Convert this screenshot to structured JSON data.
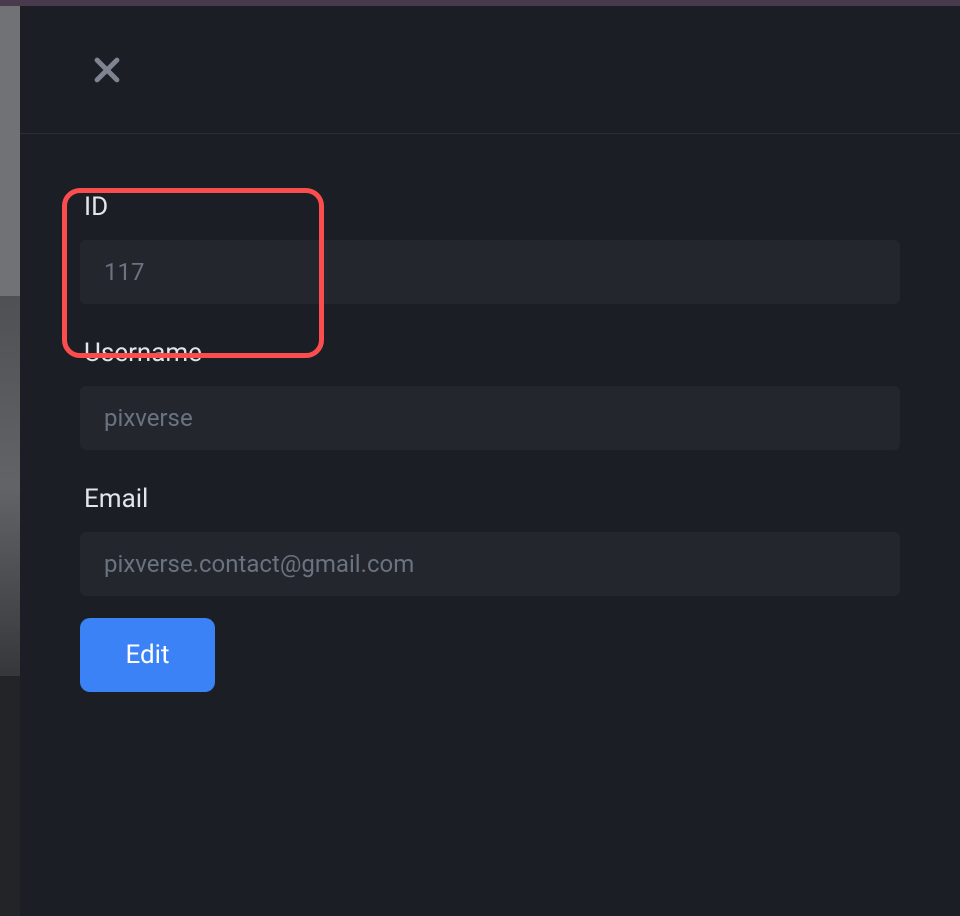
{
  "form": {
    "id": {
      "label": "ID",
      "value": "117"
    },
    "username": {
      "label": "Username",
      "value": "pixverse"
    },
    "email": {
      "label": "Email",
      "value": "pixverse.contact@gmail.com"
    },
    "edit_label": "Edit"
  }
}
